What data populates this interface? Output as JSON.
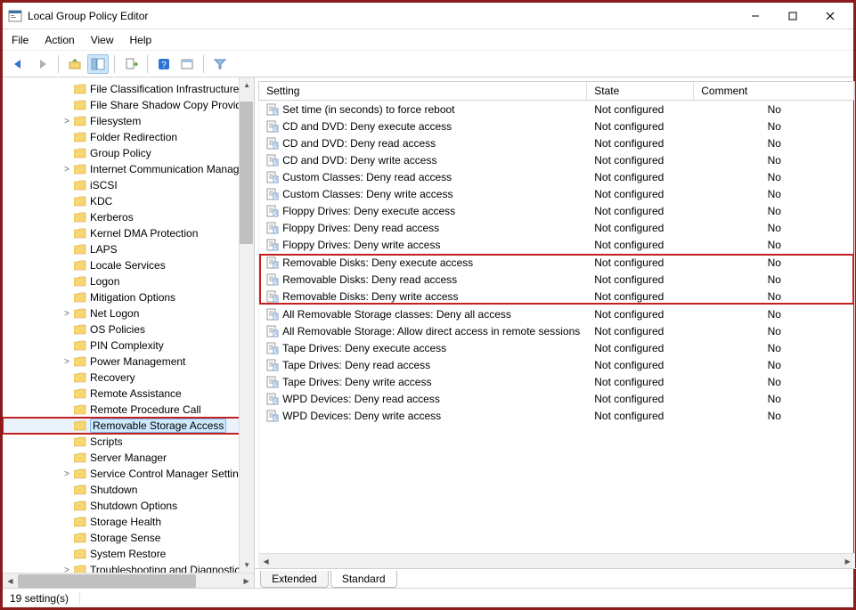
{
  "window": {
    "title": "Local Group Policy Editor"
  },
  "menus": [
    "File",
    "Action",
    "View",
    "Help"
  ],
  "tree": {
    "items": [
      {
        "label": "File Classification Infrastructure",
        "indent": 4,
        "exp": "none"
      },
      {
        "label": "File Share Shadow Copy Provider",
        "indent": 4,
        "exp": "none"
      },
      {
        "label": "Filesystem",
        "indent": 4,
        "exp": "closed"
      },
      {
        "label": "Folder Redirection",
        "indent": 4,
        "exp": "none"
      },
      {
        "label": "Group Policy",
        "indent": 4,
        "exp": "none"
      },
      {
        "label": "Internet Communication Managem",
        "indent": 4,
        "exp": "closed"
      },
      {
        "label": "iSCSI",
        "indent": 4,
        "exp": "none"
      },
      {
        "label": "KDC",
        "indent": 4,
        "exp": "none"
      },
      {
        "label": "Kerberos",
        "indent": 4,
        "exp": "none"
      },
      {
        "label": "Kernel DMA Protection",
        "indent": 4,
        "exp": "none"
      },
      {
        "label": "LAPS",
        "indent": 4,
        "exp": "none"
      },
      {
        "label": "Locale Services",
        "indent": 4,
        "exp": "none"
      },
      {
        "label": "Logon",
        "indent": 4,
        "exp": "none"
      },
      {
        "label": "Mitigation Options",
        "indent": 4,
        "exp": "none"
      },
      {
        "label": "Net Logon",
        "indent": 4,
        "exp": "closed"
      },
      {
        "label": "OS Policies",
        "indent": 4,
        "exp": "none"
      },
      {
        "label": "PIN Complexity",
        "indent": 4,
        "exp": "none"
      },
      {
        "label": "Power Management",
        "indent": 4,
        "exp": "closed"
      },
      {
        "label": "Recovery",
        "indent": 4,
        "exp": "none"
      },
      {
        "label": "Remote Assistance",
        "indent": 4,
        "exp": "none"
      },
      {
        "label": "Remote Procedure Call",
        "indent": 4,
        "exp": "none"
      },
      {
        "label": "Removable Storage Access",
        "indent": 4,
        "exp": "none",
        "highlighted": true,
        "selected": true
      },
      {
        "label": "Scripts",
        "indent": 4,
        "exp": "none"
      },
      {
        "label": "Server Manager",
        "indent": 4,
        "exp": "none"
      },
      {
        "label": "Service Control Manager Settings",
        "indent": 4,
        "exp": "closed"
      },
      {
        "label": "Shutdown",
        "indent": 4,
        "exp": "none"
      },
      {
        "label": "Shutdown Options",
        "indent": 4,
        "exp": "none"
      },
      {
        "label": "Storage Health",
        "indent": 4,
        "exp": "none"
      },
      {
        "label": "Storage Sense",
        "indent": 4,
        "exp": "none"
      },
      {
        "label": "System Restore",
        "indent": 4,
        "exp": "none"
      },
      {
        "label": "Troubleshooting and Diagnostics",
        "indent": 4,
        "exp": "closed"
      }
    ]
  },
  "columns": {
    "setting": "Setting",
    "state": "State",
    "comment": "Comment"
  },
  "settings": [
    {
      "name": "Set time (in seconds) to force reboot",
      "state": "Not configured",
      "comment": "No"
    },
    {
      "name": "CD and DVD: Deny execute access",
      "state": "Not configured",
      "comment": "No"
    },
    {
      "name": "CD and DVD: Deny read access",
      "state": "Not configured",
      "comment": "No"
    },
    {
      "name": "CD and DVD: Deny write access",
      "state": "Not configured",
      "comment": "No"
    },
    {
      "name": "Custom Classes: Deny read access",
      "state": "Not configured",
      "comment": "No"
    },
    {
      "name": "Custom Classes: Deny write access",
      "state": "Not configured",
      "comment": "No"
    },
    {
      "name": "Floppy Drives: Deny execute access",
      "state": "Not configured",
      "comment": "No"
    },
    {
      "name": "Floppy Drives: Deny read access",
      "state": "Not configured",
      "comment": "No"
    },
    {
      "name": "Floppy Drives: Deny write access",
      "state": "Not configured",
      "comment": "No"
    },
    {
      "name": "Removable Disks: Deny execute access",
      "state": "Not configured",
      "comment": "No",
      "hl": true
    },
    {
      "name": "Removable Disks: Deny read access",
      "state": "Not configured",
      "comment": "No",
      "hl": true
    },
    {
      "name": "Removable Disks: Deny write access",
      "state": "Not configured",
      "comment": "No",
      "hl": true
    },
    {
      "name": "All Removable Storage classes: Deny all access",
      "state": "Not configured",
      "comment": "No"
    },
    {
      "name": "All Removable Storage: Allow direct access in remote sessions",
      "state": "Not configured",
      "comment": "No"
    },
    {
      "name": "Tape Drives: Deny execute access",
      "state": "Not configured",
      "comment": "No"
    },
    {
      "name": "Tape Drives: Deny read access",
      "state": "Not configured",
      "comment": "No"
    },
    {
      "name": "Tape Drives: Deny write access",
      "state": "Not configured",
      "comment": "No"
    },
    {
      "name": "WPD Devices: Deny read access",
      "state": "Not configured",
      "comment": "No"
    },
    {
      "name": "WPD Devices: Deny write access",
      "state": "Not configured",
      "comment": "No"
    }
  ],
  "tabs": {
    "extended": "Extended",
    "standard": "Standard"
  },
  "status": {
    "count": "19 setting(s)"
  }
}
